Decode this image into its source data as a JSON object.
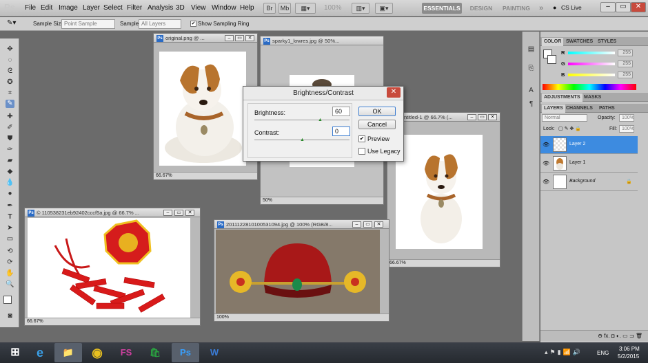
{
  "app": {
    "logo": "Ps"
  },
  "menu": [
    "File",
    "Edit",
    "Image",
    "Layer",
    "Select",
    "Filter",
    "Analysis",
    "3D",
    "View",
    "Window",
    "Help"
  ],
  "menubar_extra": {
    "zoom": "100%",
    "cs_live": "CS Live"
  },
  "workspaces": [
    "ESSENTIALS",
    "DESIGN",
    "PAINTING",
    "»"
  ],
  "options_bar": {
    "sample_size_label": "Sample Size:",
    "sample_size_value": "Point Sample",
    "sample_label": "Sample:",
    "sample_value": "All Layers",
    "show_ring_label": "Show Sampling Ring"
  },
  "documents": {
    "original": {
      "title": "original.png @ ...",
      "zoom": "66.67%"
    },
    "sparky": {
      "title": "sparky1_lowres.jpg @ 50%...",
      "zoom": "50%"
    },
    "untitled": {
      "title": "ntitled-1 @ 66.7% (...",
      "zoom": "66.67%"
    },
    "chinese": {
      "title": "© 110538231eb92402cccf5a.jpg @ 66.7% ...",
      "zoom": "66.67%"
    },
    "hat": {
      "title": "20111228101005310​94.jpg @ 100% (RGB/8...",
      "zoom": "100%"
    }
  },
  "dialog": {
    "title": "Brightness/Contrast",
    "brightness_label": "Brightness:",
    "brightness_value": "60",
    "contrast_label": "Contrast:",
    "contrast_value": "0",
    "ok_label": "OK",
    "cancel_label": "Cancel",
    "preview_label": "Preview",
    "legacy_label": "Use Legacy",
    "preview_checked": true,
    "legacy_checked": false
  },
  "color_panel": {
    "tabs": [
      "COLOR",
      "SWATCHES",
      "STYLES"
    ],
    "r_label": "R",
    "g_label": "G",
    "b_label": "B",
    "r_value": "255",
    "g_value": "255",
    "b_value": "255"
  },
  "adjustments_panel": {
    "tabs": [
      "ADJUSTMENTS",
      "MASKS"
    ]
  },
  "layers_panel": {
    "tabs": [
      "LAYERS",
      "CHANNELS",
      "PATHS"
    ],
    "blend_mode": "Normal",
    "opacity_label": "Opacity:",
    "opacity_value": "100%",
    "lock_label": "Lock:",
    "fill_label": "Fill:",
    "fill_value": "100%",
    "layers": [
      {
        "name": "Layer 2",
        "selected": true
      },
      {
        "name": "Layer 1",
        "selected": false
      },
      {
        "name": "Background",
        "selected": false
      }
    ],
    "bottom_icons": "⊖ fx. ◘ ◐. ▭ ⊐ 🗑"
  },
  "taskbar": {
    "lang": "ENG",
    "time": "3:06 PM",
    "date": "5/2/2015",
    "apps": [
      "ie",
      "explorer",
      "chrome",
      "FS",
      "store",
      "Ps",
      "W"
    ]
  },
  "colors": {
    "accent": "#3d8be0",
    "close": "#c84a3c"
  }
}
